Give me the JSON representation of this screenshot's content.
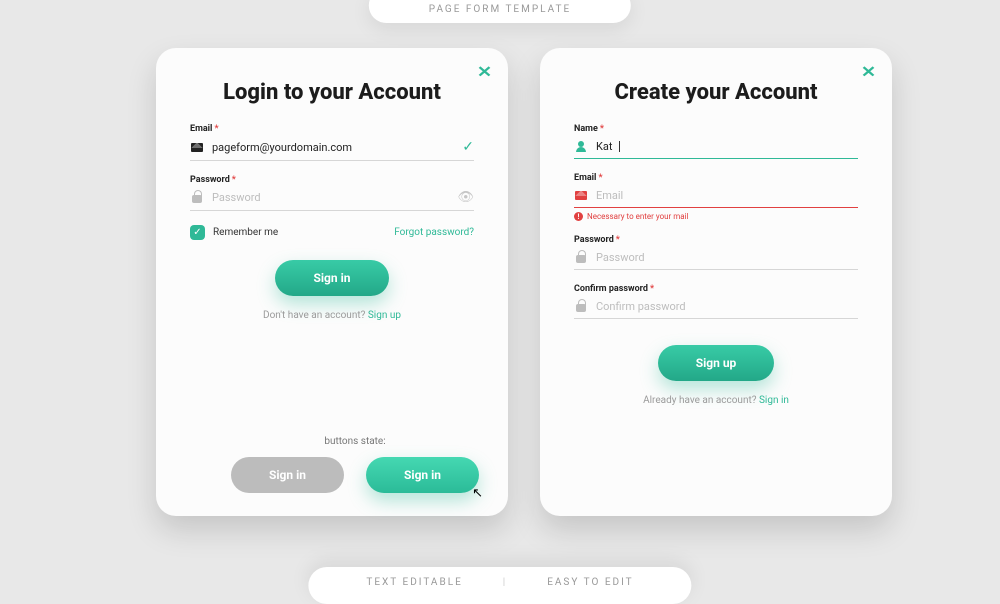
{
  "header_pill": "PAGE FORM TEMPLATE",
  "footer_pill": {
    "left": "TEXT EDITABLE",
    "right": "EASY TO EDIT"
  },
  "login": {
    "title": "Login to your Account",
    "email_label": "Email",
    "email_value": "pageform@yourdomain.com",
    "password_label": "Password",
    "password_placeholder": "Password",
    "remember_label": "Remember me",
    "forgot_label": "Forgot password?",
    "submit_label": "Sign in",
    "footer_text": "Don't have an account? ",
    "footer_link": "Sign up"
  },
  "signup": {
    "title": "Create your Account",
    "name_label": "Name",
    "name_value": "Kat",
    "email_label": "Email",
    "email_placeholder": "Email",
    "email_error": "Necessary to enter your mail",
    "password_label": "Password",
    "password_placeholder": "Password",
    "confirm_label": "Confirm password",
    "confirm_placeholder": "Confirm password",
    "submit_label": "Sign up",
    "footer_text": "Already have an account? ",
    "footer_link": "Sign in"
  },
  "states": {
    "label": "buttons state:",
    "disabled_label": "Sign in",
    "hover_label": "Sign in"
  }
}
